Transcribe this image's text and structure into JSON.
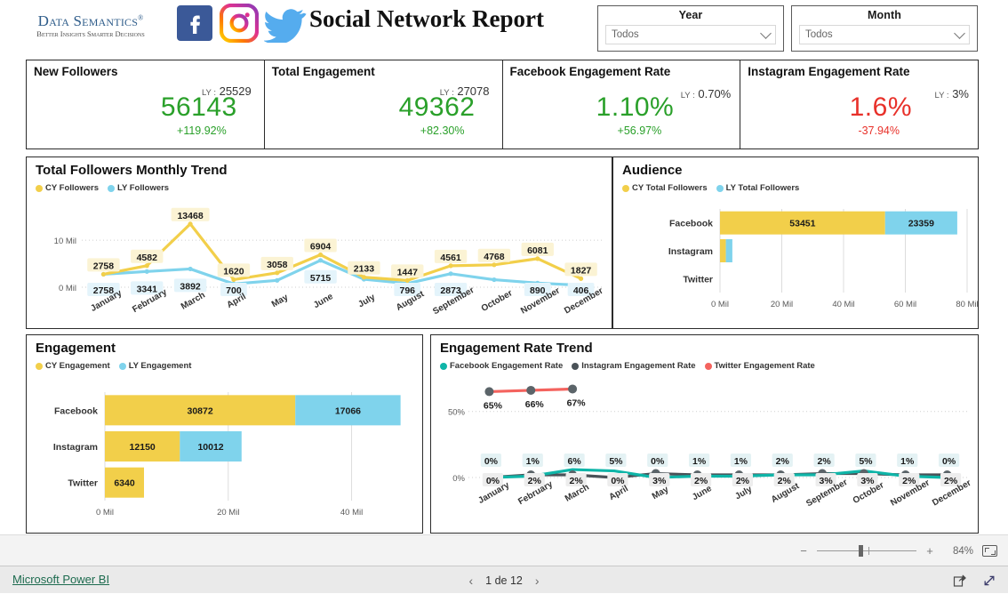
{
  "header": {
    "logo_main": "Data Semantics",
    "logo_registered": "®",
    "logo_sub": "Better Insights Smarter Decisions",
    "report_title": "Social Network Report",
    "social_icons": [
      "facebook-icon",
      "instagram-icon",
      "twitter-icon"
    ]
  },
  "slicers": [
    {
      "title": "Year",
      "value": "Todos",
      "icon": "chevron-down-icon"
    },
    {
      "title": "Month",
      "value": "Todos",
      "icon": "chevron-down-icon"
    }
  ],
  "kpis": [
    {
      "title": "New Followers",
      "ly_label": "LY :",
      "ly_value": "25529",
      "value": "56143",
      "delta": "+119.92%",
      "trend": "up",
      "color": "#2aa02a"
    },
    {
      "title": "Total Engagement",
      "ly_label": "LY :",
      "ly_value": "27078",
      "value": "49362",
      "delta": "+82.30%",
      "trend": "up",
      "color": "#2aa02a"
    },
    {
      "title": "Facebook Engagement Rate",
      "ly_label": "LY :",
      "ly_value": "0.70%",
      "value": "1.10%",
      "delta": "+56.97%",
      "trend": "up",
      "color": "#2aa02a"
    },
    {
      "title": "Instagram Engagement Rate",
      "ly_label": "LY :",
      "ly_value": "3%",
      "value": "1.6%",
      "delta": "-37.94%",
      "trend": "down",
      "color": "#e8312a"
    }
  ],
  "colors": {
    "cy_yellow": "#f2cf4a",
    "ly_blue": "#7fd3ec",
    "facebook_teal": "#0fb5a8",
    "instagram_gray": "#4a5258",
    "twitter_red": "#f4635e"
  },
  "panels": {
    "trend": {
      "title": "Total Followers Monthly Trend"
    },
    "audience": {
      "title": "Audience"
    },
    "engage": {
      "title": "Engagement"
    },
    "ertrend": {
      "title": "Engagement Rate Trend"
    }
  },
  "chart_data": [
    {
      "id": "total-followers-monthly-trend",
      "type": "line",
      "title": "Total Followers Monthly Trend",
      "xlabel": "",
      "ylabel": "",
      "ylim": [
        0,
        14000
      ],
      "yticks": [
        0,
        10000
      ],
      "ytick_labels": [
        "0 Mil",
        "10 Mil"
      ],
      "grid": true,
      "legend_position": "top-left",
      "categories": [
        "January",
        "February",
        "March",
        "April",
        "May",
        "June",
        "July",
        "August",
        "September",
        "October",
        "November",
        "December"
      ],
      "series": [
        {
          "name": "CY Followers",
          "color": "#f2cf4a",
          "values": [
            2758,
            4582,
            13468,
            1620,
            3058,
            6904,
            2133,
            1447,
            4561,
            4768,
            6081,
            1827
          ],
          "labels": [
            "2758",
            "4582",
            "13468",
            "1620",
            "3058",
            "6904",
            "2133",
            "1447",
            "4561",
            "4768",
            "6081",
            "1827"
          ]
        },
        {
          "name": "LY Followers",
          "color": "#7fd3ec",
          "values": [
            2758,
            3341,
            3892,
            700,
            1450,
            5715,
            1700,
            796,
            2873,
            1600,
            890,
            406
          ],
          "labels": [
            "2758",
            "3341",
            "3892",
            "700",
            "",
            "5715",
            "",
            "796",
            "2873",
            "",
            "890",
            "406"
          ]
        }
      ]
    },
    {
      "id": "audience",
      "type": "bar",
      "orientation": "horizontal",
      "stacked": true,
      "title": "Audience",
      "xlabel": "",
      "ylabel": "",
      "xlim": [
        0,
        80000
      ],
      "xticks": [
        0,
        20000,
        40000,
        60000,
        80000
      ],
      "xtick_labels": [
        "0 Mil",
        "20 Mil",
        "40 Mil",
        "60 Mil",
        "80 Mil"
      ],
      "grid": true,
      "legend_position": "top-left",
      "categories": [
        "Facebook",
        "Instagram",
        "Twitter"
      ],
      "series": [
        {
          "name": "CY Total Followers",
          "color": "#f2cf4a",
          "values": [
            53451,
            1900,
            0
          ],
          "labels": [
            "53451",
            "",
            ""
          ]
        },
        {
          "name": "LY Total Followers",
          "color": "#7fd3ec",
          "values": [
            23359,
            2100,
            0
          ],
          "labels": [
            "23359",
            "",
            ""
          ]
        }
      ]
    },
    {
      "id": "engagement",
      "type": "bar",
      "orientation": "horizontal",
      "stacked": true,
      "title": "Engagement",
      "xlabel": "",
      "ylabel": "",
      "xlim": [
        0,
        49000
      ],
      "xticks": [
        0,
        20000,
        40000
      ],
      "xtick_labels": [
        "0 Mil",
        "20 Mil",
        "40 Mil"
      ],
      "grid": true,
      "legend_position": "top-left",
      "categories": [
        "Facebook",
        "Instagram",
        "Twitter"
      ],
      "series": [
        {
          "name": "CY Engagement",
          "color": "#f2cf4a",
          "values": [
            30872,
            12150,
            6340
          ],
          "labels": [
            "30872",
            "12150",
            "6340"
          ]
        },
        {
          "name": "LY Engagement",
          "color": "#7fd3ec",
          "values": [
            17066,
            10012,
            0
          ],
          "labels": [
            "17066",
            "10012",
            ""
          ]
        }
      ]
    },
    {
      "id": "engagement-rate-trend",
      "type": "line",
      "title": "Engagement Rate Trend",
      "xlabel": "",
      "ylabel": "",
      "ylim": [
        0,
        0.7
      ],
      "yticks": [
        0,
        0.5
      ],
      "ytick_labels": [
        "0%",
        "50%"
      ],
      "grid": true,
      "legend_position": "top-left",
      "categories": [
        "January",
        "February",
        "March",
        "April",
        "May",
        "June",
        "July",
        "August",
        "September",
        "October",
        "November",
        "December"
      ],
      "series": [
        {
          "name": "Facebook Engagement Rate",
          "color": "#0fb5a8",
          "values": [
            0.0,
            0.01,
            0.06,
            0.05,
            0.0,
            0.01,
            0.01,
            0.02,
            0.02,
            0.05,
            0.01,
            0.0
          ],
          "labels": [
            "0%",
            "1%",
            "6%",
            "5%",
            "0%",
            "1%",
            "1%",
            "2%",
            "2%",
            "5%",
            "1%",
            "0%"
          ]
        },
        {
          "name": "Instagram Engagement Rate",
          "color": "#4a5258",
          "values": [
            0.0,
            0.02,
            0.02,
            0.0,
            0.03,
            0.02,
            0.02,
            0.02,
            0.03,
            0.03,
            0.02,
            0.02
          ],
          "labels": [
            "0%",
            "2%",
            "2%",
            "0%",
            "3%",
            "2%",
            "2%",
            "2%",
            "3%",
            "3%",
            "2%",
            "2%"
          ]
        },
        {
          "name": "Twitter Engagement Rate",
          "color": "#f4635e",
          "values": [
            0.65,
            0.66,
            0.67,
            null,
            null,
            null,
            null,
            null,
            null,
            null,
            null,
            null
          ],
          "labels": [
            "65%",
            "66%",
            "67%",
            "",
            "",
            "",
            "",
            "",
            "",
            "",
            "",
            ""
          ]
        }
      ]
    }
  ],
  "zoombar": {
    "minus": "−",
    "plus": "+",
    "percent": "84%",
    "fit_icon": "fit-to-page-icon"
  },
  "footer": {
    "link": "Microsoft Power BI",
    "prev_icon": "‹",
    "next_icon": "›",
    "page_text": "1 de 12",
    "share_icon": "share-icon",
    "fullscreen_icon": "fullscreen-icon"
  }
}
